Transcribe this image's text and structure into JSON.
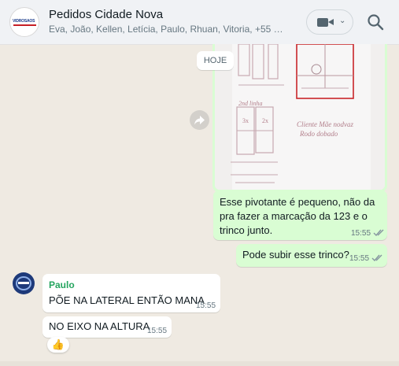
{
  "header": {
    "logo_text": "VIDROSAOS",
    "title": "Pedidos Cidade Nova",
    "members": "Eva, João, Kellen, Letícia, Paulo, Rhuan, Vitoria, +55 92 9...",
    "video_chevron": "⌄"
  },
  "date_chip": "HOJE",
  "image_message": {
    "handwriting": [
      "Cliente Mãe nodvaz",
      "Rodo dobado",
      "2nd linha",
      "3x",
      "2x"
    ]
  },
  "messages": [
    {
      "id": "m1",
      "direction": "out",
      "text": "Esse pivotante é pequeno, não da pra fazer a marcação da 123 e o trinco junto.",
      "time": "15:55",
      "status": "delivered"
    },
    {
      "id": "m2",
      "direction": "out",
      "text": "Pode subir esse trinco?",
      "time": "15:55",
      "status": "delivered"
    },
    {
      "id": "m3",
      "direction": "in",
      "sender": "Paulo",
      "text": "PÕE NA LATERAL ENTÃO MANA",
      "time": "15:55"
    },
    {
      "id": "m4",
      "direction": "in",
      "text": "NO EIXO NA ALTURA",
      "time": "15:55",
      "reaction": "👍"
    }
  ],
  "colors": {
    "outgoing_bubble": "#d9fdd3",
    "incoming_bubble": "#ffffff",
    "chat_background": "#efeae2",
    "sender_name": "#25a55f",
    "ticks": "#8696a0"
  }
}
